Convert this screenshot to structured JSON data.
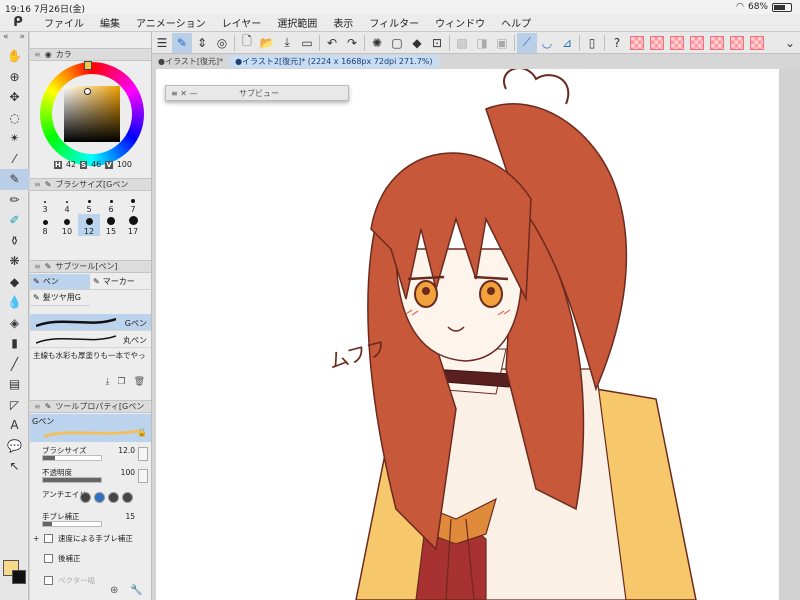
{
  "status_bar": {
    "time": "19:16",
    "date": "7月26日(金)",
    "battery": "68%",
    "battery_level": 0.68
  },
  "menu": [
    "ファイル",
    "編集",
    "アニメーション",
    "レイヤー",
    "選択範囲",
    "表示",
    "フィルター",
    "ウィンドウ",
    "ヘルプ"
  ],
  "tools": [
    {
      "icon": "hand-icon",
      "glyph": "✋"
    },
    {
      "icon": "zoom-icon",
      "glyph": "⊕"
    },
    {
      "icon": "move-icon",
      "glyph": "✥"
    },
    {
      "icon": "lasso-icon",
      "glyph": "◌"
    },
    {
      "icon": "magic-wand-icon",
      "glyph": "✴"
    },
    {
      "icon": "eyedropper-icon",
      "glyph": "⁄"
    },
    {
      "icon": "pen-icon",
      "glyph": "✎"
    },
    {
      "icon": "pencil-icon",
      "glyph": "✏"
    },
    {
      "icon": "brush-icon",
      "glyph": "✐"
    },
    {
      "icon": "airbrush-icon",
      "glyph": "⚱"
    },
    {
      "icon": "decoration-icon",
      "glyph": "❋"
    },
    {
      "icon": "eraser-icon",
      "glyph": "◆"
    },
    {
      "icon": "blend-icon",
      "glyph": "💧"
    },
    {
      "icon": "fill-icon",
      "glyph": "◈"
    },
    {
      "icon": "gradient-icon",
      "glyph": "▮"
    },
    {
      "icon": "figure-icon",
      "glyph": "╱"
    },
    {
      "icon": "frame-icon",
      "glyph": "▤"
    },
    {
      "icon": "ruler-icon",
      "glyph": "◸"
    },
    {
      "icon": "text-icon",
      "glyph": "A"
    },
    {
      "icon": "balloon-icon",
      "glyph": "💬"
    },
    {
      "icon": "correct-line-icon",
      "glyph": "↖"
    }
  ],
  "panel": {
    "color_title": "カラ",
    "color_h_label": "H",
    "color_h": "42",
    "color_s_label": "S",
    "color_s": "46",
    "color_v_label": "V",
    "color_v": "100",
    "brush_size_title": "ブラシサイズ[Gペン",
    "sizes": [
      {
        "label": "3",
        "dot": 2
      },
      {
        "label": "4",
        "dot": 2
      },
      {
        "label": "5",
        "dot": 3
      },
      {
        "label": "6",
        "dot": 3
      },
      {
        "label": "7",
        "dot": 4
      },
      {
        "label": "8",
        "dot": 5
      },
      {
        "label": "10",
        "dot": 6
      },
      {
        "label": "12",
        "dot": 7
      },
      {
        "label": "15",
        "dot": 8
      },
      {
        "label": "17",
        "dot": 9
      }
    ],
    "subtool_title": "サブツール[ペン]",
    "subtool_tabs": [
      "ペン",
      "マーカー",
      "髪ツヤ用G"
    ],
    "strokes": [
      "Gペン",
      "丸ペン"
    ],
    "subtool_note": "主線も水彩も厚塗りも一本でやっ",
    "tool_property_title": "ツールプロパティ[Gペン",
    "tool_name": "Gペン",
    "brush_size_label": "ブラシサイズ",
    "brush_size": "12.0",
    "opacity_label": "不透明度",
    "opacity": "100",
    "antialias_label": "アンチエイリ",
    "stabilization_label": "手ブレ補正",
    "stabilization": "15",
    "speed_stab_label": "速度による手ブレ補正",
    "post_label": "後補正",
    "vector_label": "ベクター吸"
  },
  "tabs": [
    "イラスト[復元]*",
    "イラスト2[復元]* (2224 x 1668px 72dpi 271.7%)"
  ],
  "subview_title": "サブビュー",
  "canvas": {
    "annotation": "ムフフ"
  },
  "colors": {
    "hair": "#c8583a",
    "line": "#6b2a1f",
    "cardigan": "#f6c76b",
    "ribbon": "#a83232",
    "accent": "#1f6ac4"
  }
}
